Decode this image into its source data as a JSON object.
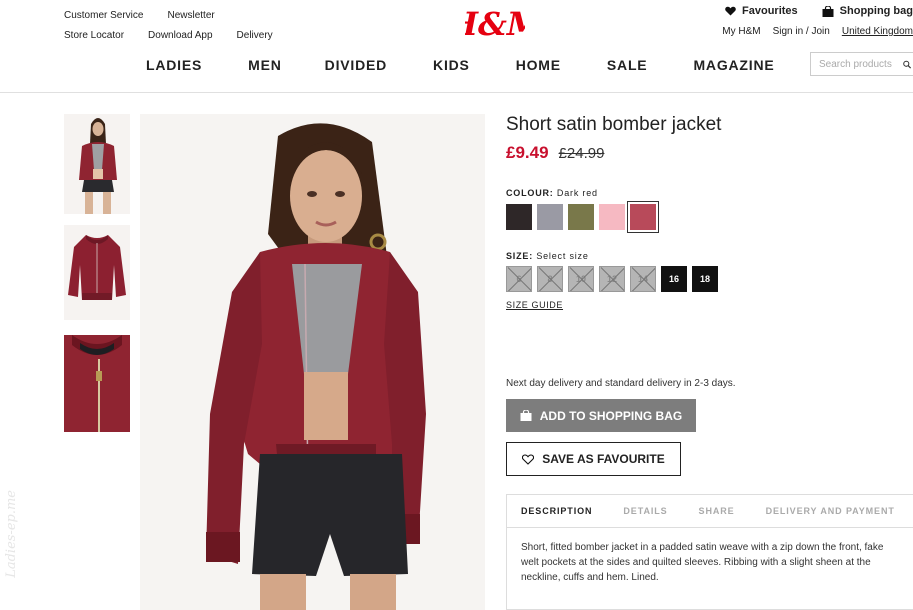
{
  "utility_links": {
    "row1": [
      "Customer Service",
      "Newsletter"
    ],
    "row2": [
      "Store Locator",
      "Download App",
      "Delivery"
    ]
  },
  "brand": "H&M",
  "account": {
    "favourites": "Favourites",
    "shopping_bag": "Shopping bag",
    "my_hm": "My H&M",
    "sign_in": "Sign in / Join",
    "country": "United Kingdom"
  },
  "nav": {
    "ladies": "LADIES",
    "men": "MEN",
    "divided": "DIVIDED",
    "kids": "KIDS",
    "home": "HOME",
    "sale": "SALE",
    "magazine": "MAGAZINE"
  },
  "search": {
    "placeholder": "Search products"
  },
  "product": {
    "title": "Short satin bomber jacket",
    "price": "£9.49",
    "old_price": "£24.99",
    "colour_label": "COLOUR:",
    "colour_value": "Dark red",
    "colours": [
      {
        "name": "black",
        "hex": "#2e2728"
      },
      {
        "name": "grey",
        "hex": "#9a9aa4"
      },
      {
        "name": "khaki",
        "hex": "#79784a"
      },
      {
        "name": "light-pink",
        "hex": "#f6b9c2"
      },
      {
        "name": "dark-red",
        "hex": "#b84a5a",
        "selected": true
      }
    ],
    "size_label": "SIZE:",
    "size_hint": "Select size",
    "sizes": [
      {
        "label": "6",
        "available": false
      },
      {
        "label": "8",
        "available": false
      },
      {
        "label": "10",
        "available": false
      },
      {
        "label": "12",
        "available": false
      },
      {
        "label": "14",
        "available": false
      },
      {
        "label": "16",
        "available": true
      },
      {
        "label": "18",
        "available": true
      }
    ],
    "size_guide": "SIZE GUIDE",
    "delivery_note": "Next day delivery and standard delivery in 2-3 days.",
    "add_to_bag": "ADD TO SHOPPING BAG",
    "save_favourite": "SAVE AS FAVOURITE"
  },
  "tabs": {
    "description": "DESCRIPTION",
    "details": "DETAILS",
    "share": "SHARE",
    "delivery_payment": "DELIVERY AND PAYMENT"
  },
  "description_text": "Short, fitted bomber jacket in a padded satin weave with a zip down the front, fake welt pockets at the sides and quilted sleeves. Ribbing with a slight sheen at the neckline, cuffs and hem. Lined.",
  "watermark": "Ladies-ep.me",
  "colors": {
    "sale_red": "#c8102e",
    "jacket_red": "#8f2431",
    "button_grey": "#7d7d7d"
  }
}
